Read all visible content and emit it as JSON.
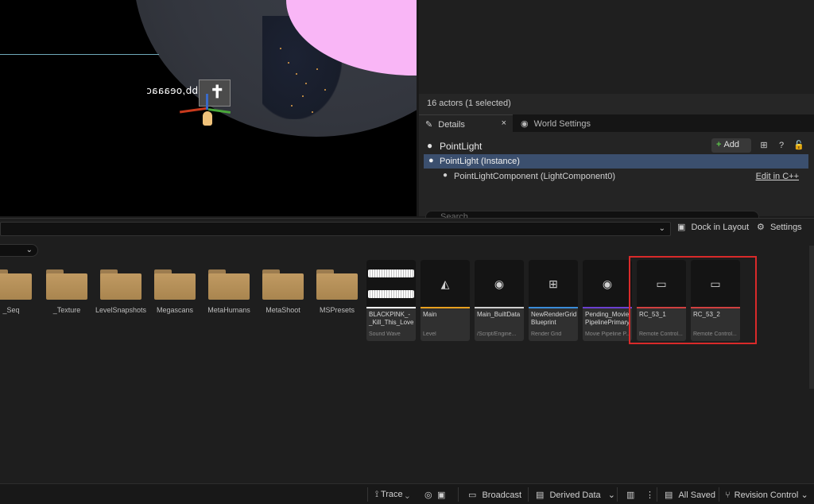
{
  "viewport": {
    "actor_label": "[aw'bb,oeaaac"
  },
  "outliner": {
    "status": "16 actors (1 selected)"
  },
  "tabs": {
    "details": "Details",
    "details_close": "×",
    "world_settings": "World Settings"
  },
  "details": {
    "title": "PointLight",
    "add_label": "Add",
    "tree": [
      {
        "label": "PointLight (Instance)"
      },
      {
        "label": "PointLightComponent (LightComponent0)",
        "action": "Edit in C++"
      }
    ],
    "search_placeholder": "Search"
  },
  "content_browser": {
    "dock_label": "Dock in Layout",
    "settings_label": "Settings",
    "folders": [
      {
        "label": "_Seq"
      },
      {
        "label": "_Texture"
      },
      {
        "label": "LevelSnapshots"
      },
      {
        "label": "Megascans"
      },
      {
        "label": "MetaHumans"
      },
      {
        "label": "MetaShoot"
      },
      {
        "label": "MSPresets"
      }
    ],
    "assets": [
      {
        "name": "BLACKPINK_-_Kill_This_Love",
        "type": "Sound Wave",
        "bar_color": "#ffffff"
      },
      {
        "name": "Main",
        "type": "Level",
        "bar_color": "#e8a020"
      },
      {
        "name": "Main_BuiltData",
        "type": "/Script/Engine...",
        "bar_color": "#cfcfcf"
      },
      {
        "name": "NewRenderGrid Blueprint",
        "type": "Render Grid",
        "bar_color": "#3a8cd8"
      },
      {
        "name": "Pending_Movie PipelinePrimary",
        "type": "Movie Pipeline P...",
        "bar_color": "#6a3fd0"
      },
      {
        "name": "RC_53_1",
        "type": "Remote Control...",
        "bar_color": "#d04040"
      },
      {
        "name": "RC_53_2",
        "type": "Remote Control...",
        "bar_color": "#d04040"
      }
    ]
  },
  "statusbar": {
    "trace": "Trace",
    "broadcast": "Broadcast",
    "derived_data": "Derived Data",
    "all_saved": "All Saved",
    "revision_control": "Revision Control"
  }
}
